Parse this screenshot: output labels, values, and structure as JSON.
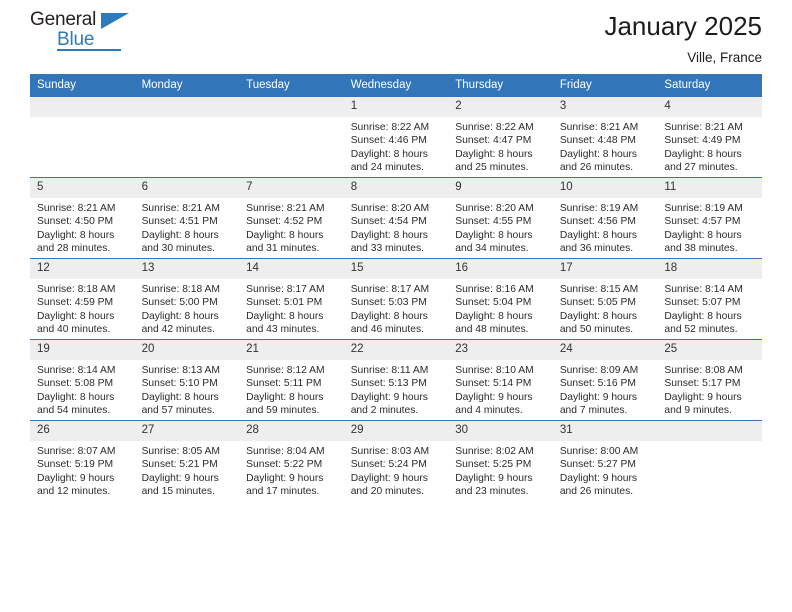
{
  "brand": {
    "name_part1": "General",
    "name_part2": "Blue",
    "logo_icon": "triangle-flag-icon"
  },
  "header": {
    "title": "January 2025",
    "location": "Ville, France"
  },
  "colors": {
    "header_blue": "#3275b8",
    "daynum_gray": "#eeeeee",
    "brand_blue": "#2b7bbd",
    "text": "#2b2b2b"
  },
  "calendar": {
    "weekday_headers": [
      "Sunday",
      "Monday",
      "Tuesday",
      "Wednesday",
      "Thursday",
      "Friday",
      "Saturday"
    ],
    "weeks": [
      [
        {
          "day": "",
          "lines": []
        },
        {
          "day": "",
          "lines": []
        },
        {
          "day": "",
          "lines": []
        },
        {
          "day": "1",
          "lines": [
            "Sunrise: 8:22 AM",
            "Sunset: 4:46 PM",
            "Daylight: 8 hours",
            "and 24 minutes."
          ]
        },
        {
          "day": "2",
          "lines": [
            "Sunrise: 8:22 AM",
            "Sunset: 4:47 PM",
            "Daylight: 8 hours",
            "and 25 minutes."
          ]
        },
        {
          "day": "3",
          "lines": [
            "Sunrise: 8:21 AM",
            "Sunset: 4:48 PM",
            "Daylight: 8 hours",
            "and 26 minutes."
          ]
        },
        {
          "day": "4",
          "lines": [
            "Sunrise: 8:21 AM",
            "Sunset: 4:49 PM",
            "Daylight: 8 hours",
            "and 27 minutes."
          ]
        }
      ],
      [
        {
          "day": "5",
          "lines": [
            "Sunrise: 8:21 AM",
            "Sunset: 4:50 PM",
            "Daylight: 8 hours",
            "and 28 minutes."
          ]
        },
        {
          "day": "6",
          "lines": [
            "Sunrise: 8:21 AM",
            "Sunset: 4:51 PM",
            "Daylight: 8 hours",
            "and 30 minutes."
          ]
        },
        {
          "day": "7",
          "lines": [
            "Sunrise: 8:21 AM",
            "Sunset: 4:52 PM",
            "Daylight: 8 hours",
            "and 31 minutes."
          ]
        },
        {
          "day": "8",
          "lines": [
            "Sunrise: 8:20 AM",
            "Sunset: 4:54 PM",
            "Daylight: 8 hours",
            "and 33 minutes."
          ]
        },
        {
          "day": "9",
          "lines": [
            "Sunrise: 8:20 AM",
            "Sunset: 4:55 PM",
            "Daylight: 8 hours",
            "and 34 minutes."
          ]
        },
        {
          "day": "10",
          "lines": [
            "Sunrise: 8:19 AM",
            "Sunset: 4:56 PM",
            "Daylight: 8 hours",
            "and 36 minutes."
          ]
        },
        {
          "day": "11",
          "lines": [
            "Sunrise: 8:19 AM",
            "Sunset: 4:57 PM",
            "Daylight: 8 hours",
            "and 38 minutes."
          ]
        }
      ],
      [
        {
          "day": "12",
          "lines": [
            "Sunrise: 8:18 AM",
            "Sunset: 4:59 PM",
            "Daylight: 8 hours",
            "and 40 minutes."
          ]
        },
        {
          "day": "13",
          "lines": [
            "Sunrise: 8:18 AM",
            "Sunset: 5:00 PM",
            "Daylight: 8 hours",
            "and 42 minutes."
          ]
        },
        {
          "day": "14",
          "lines": [
            "Sunrise: 8:17 AM",
            "Sunset: 5:01 PM",
            "Daylight: 8 hours",
            "and 43 minutes."
          ]
        },
        {
          "day": "15",
          "lines": [
            "Sunrise: 8:17 AM",
            "Sunset: 5:03 PM",
            "Daylight: 8 hours",
            "and 46 minutes."
          ]
        },
        {
          "day": "16",
          "lines": [
            "Sunrise: 8:16 AM",
            "Sunset: 5:04 PM",
            "Daylight: 8 hours",
            "and 48 minutes."
          ]
        },
        {
          "day": "17",
          "lines": [
            "Sunrise: 8:15 AM",
            "Sunset: 5:05 PM",
            "Daylight: 8 hours",
            "and 50 minutes."
          ]
        },
        {
          "day": "18",
          "lines": [
            "Sunrise: 8:14 AM",
            "Sunset: 5:07 PM",
            "Daylight: 8 hours",
            "and 52 minutes."
          ]
        }
      ],
      [
        {
          "day": "19",
          "lines": [
            "Sunrise: 8:14 AM",
            "Sunset: 5:08 PM",
            "Daylight: 8 hours",
            "and 54 minutes."
          ]
        },
        {
          "day": "20",
          "lines": [
            "Sunrise: 8:13 AM",
            "Sunset: 5:10 PM",
            "Daylight: 8 hours",
            "and 57 minutes."
          ]
        },
        {
          "day": "21",
          "lines": [
            "Sunrise: 8:12 AM",
            "Sunset: 5:11 PM",
            "Daylight: 8 hours",
            "and 59 minutes."
          ]
        },
        {
          "day": "22",
          "lines": [
            "Sunrise: 8:11 AM",
            "Sunset: 5:13 PM",
            "Daylight: 9 hours",
            "and 2 minutes."
          ]
        },
        {
          "day": "23",
          "lines": [
            "Sunrise: 8:10 AM",
            "Sunset: 5:14 PM",
            "Daylight: 9 hours",
            "and 4 minutes."
          ]
        },
        {
          "day": "24",
          "lines": [
            "Sunrise: 8:09 AM",
            "Sunset: 5:16 PM",
            "Daylight: 9 hours",
            "and 7 minutes."
          ]
        },
        {
          "day": "25",
          "lines": [
            "Sunrise: 8:08 AM",
            "Sunset: 5:17 PM",
            "Daylight: 9 hours",
            "and 9 minutes."
          ]
        }
      ],
      [
        {
          "day": "26",
          "lines": [
            "Sunrise: 8:07 AM",
            "Sunset: 5:19 PM",
            "Daylight: 9 hours",
            "and 12 minutes."
          ]
        },
        {
          "day": "27",
          "lines": [
            "Sunrise: 8:05 AM",
            "Sunset: 5:21 PM",
            "Daylight: 9 hours",
            "and 15 minutes."
          ]
        },
        {
          "day": "28",
          "lines": [
            "Sunrise: 8:04 AM",
            "Sunset: 5:22 PM",
            "Daylight: 9 hours",
            "and 17 minutes."
          ]
        },
        {
          "day": "29",
          "lines": [
            "Sunrise: 8:03 AM",
            "Sunset: 5:24 PM",
            "Daylight: 9 hours",
            "and 20 minutes."
          ]
        },
        {
          "day": "30",
          "lines": [
            "Sunrise: 8:02 AM",
            "Sunset: 5:25 PM",
            "Daylight: 9 hours",
            "and 23 minutes."
          ]
        },
        {
          "day": "31",
          "lines": [
            "Sunrise: 8:00 AM",
            "Sunset: 5:27 PM",
            "Daylight: 9 hours",
            "and 26 minutes."
          ]
        },
        {
          "day": "",
          "lines": []
        }
      ]
    ]
  }
}
